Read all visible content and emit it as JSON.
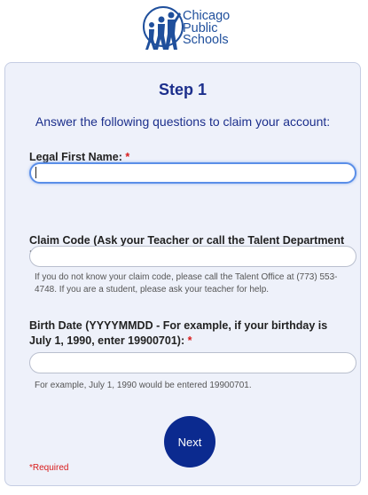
{
  "logo": {
    "line1": "Chicago",
    "line2": "Public",
    "line3": "Schools",
    "color": "#1f4f9c"
  },
  "form": {
    "step_title": "Step 1",
    "intro": "Answer the following questions to claim your account:",
    "first_name": {
      "label": "Legal First Name:",
      "required_mark": "*",
      "value": ""
    },
    "claim_code": {
      "label": "Claim Code (Ask your Teacher or call the Talent Department if you don't know your code):",
      "required_mark": "*",
      "value": "",
      "help": "If you do not know your claim code, please call the Talent Office at (773) 553-4748. If you are a student, please ask your teacher for help."
    },
    "birth_date": {
      "label": "Birth Date (YYYYMMDD - For example, if your birthday is July 1, 1990, enter 19900701):",
      "required_mark": "*",
      "value": "",
      "help": "For example, July 1, 1990 would be entered 19900701."
    },
    "next_label": "Next",
    "required_note": "*Required"
  },
  "colors": {
    "accent": "#1c2f8c",
    "button": "#0b2a8f",
    "required": "#d81b1b",
    "card_bg": "#eef1fa",
    "focus": "#5b8fe8"
  }
}
